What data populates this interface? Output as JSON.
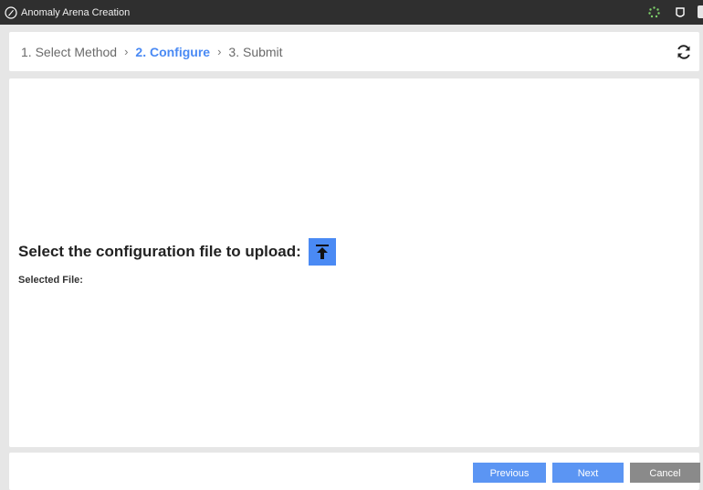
{
  "window": {
    "title": "Anomaly Arena Creation"
  },
  "steps": [
    {
      "label": "1. Select Method"
    },
    {
      "label": "2. Configure"
    },
    {
      "label": "3. Submit"
    }
  ],
  "upload": {
    "prompt": "Select the configuration file to upload:",
    "selected_file_label": "Selected File:"
  },
  "footer": {
    "previous_label": "Previous",
    "next_label": "Next",
    "cancel_label": "Cancel"
  },
  "icons": {
    "app": "compass-icon",
    "spinner": "loading-spinner-icon",
    "shield": "shield-icon",
    "refresh": "refresh-icon",
    "upload": "upload-icon",
    "chevron": "chevron-right-icon"
  },
  "colors": {
    "accent": "#4a8af4",
    "titlebar": "#2f2f2f",
    "cancel": "#8a8a8a",
    "background": "#e6e6e6"
  }
}
